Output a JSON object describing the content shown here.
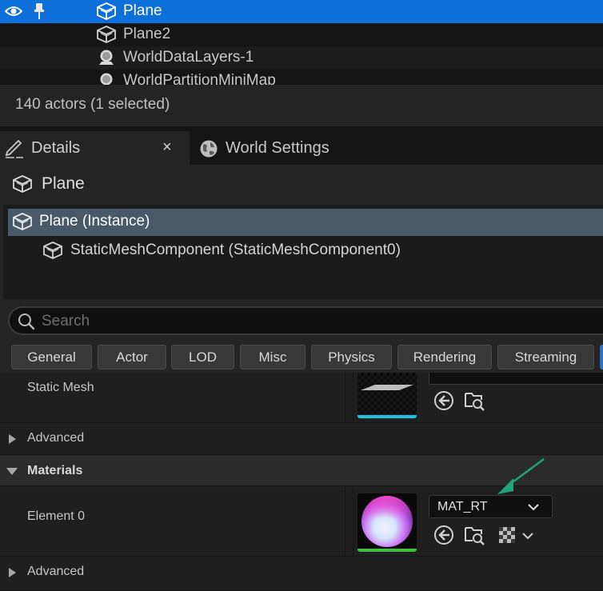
{
  "outliner": {
    "rows": [
      {
        "label": "Plane",
        "selected": true
      },
      {
        "label": "Plane2",
        "selected": false
      },
      {
        "label": "WorldDataLayers-1",
        "selected": false
      },
      {
        "label": "WorldPartitionMiniMap",
        "selected": false
      }
    ],
    "status": "140 actors (1 selected)"
  },
  "tabs": {
    "details": {
      "label": "Details",
      "close": "×"
    },
    "world_settings": {
      "label": "World Settings"
    }
  },
  "details": {
    "actor_name": "Plane",
    "tree": {
      "root": "Plane (Instance)",
      "child": "StaticMeshComponent (StaticMeshComponent0)"
    },
    "search": {
      "placeholder": "Search"
    },
    "filters": [
      "General",
      "Actor",
      "LOD",
      "Misc",
      "Physics",
      "Rendering",
      "Streaming"
    ],
    "static_mesh": {
      "label": "Static Mesh"
    },
    "advanced_1": {
      "label": "Advanced"
    },
    "materials_section": {
      "label": "Materials"
    },
    "element0": {
      "label": "Element 0",
      "material": "MAT_RT"
    },
    "advanced_2": {
      "label": "Advanced"
    }
  },
  "colors": {
    "selection": "#0d6fd9",
    "tree_selection": "#4a5968",
    "mesh_bar": "#19c8e0",
    "material_bar": "#3fbf3f",
    "annotation_arrow": "#1fa37a"
  }
}
